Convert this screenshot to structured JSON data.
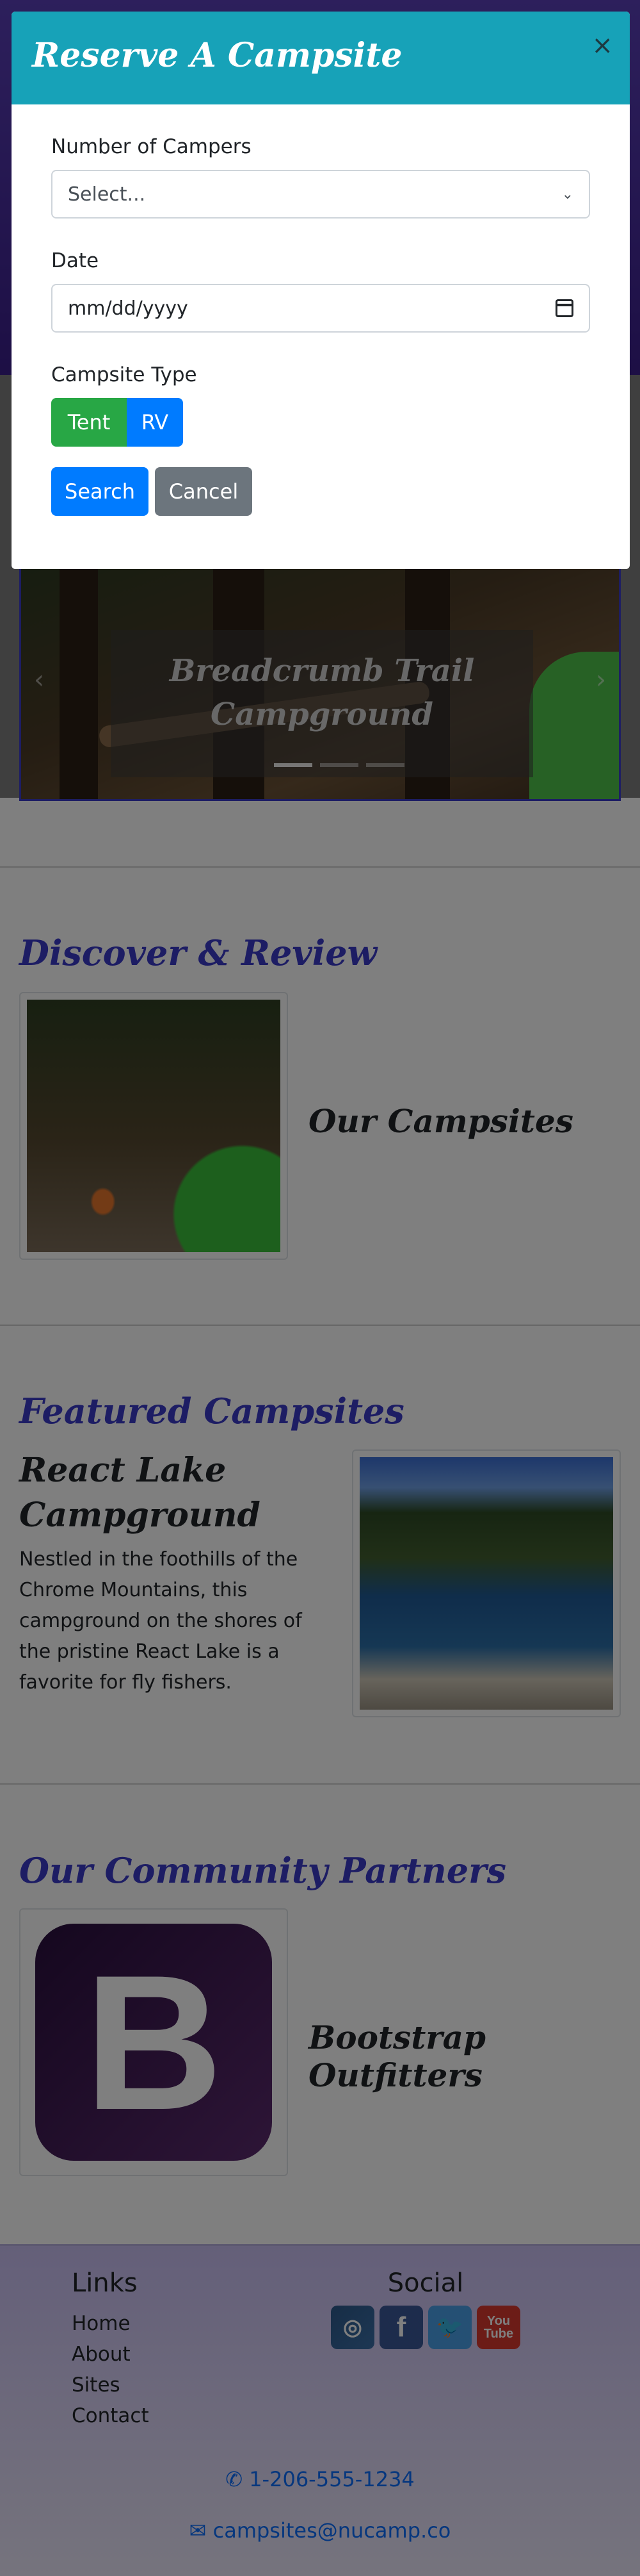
{
  "modal": {
    "title": "Reserve A Campsite",
    "close_glyph": "×",
    "campers_label": "Number of Campers",
    "campers_value": "Select...",
    "date_label": "Date",
    "date_value": "mm/dd/yyyy",
    "type_label": "Campsite Type",
    "type_options": [
      "Tent",
      "RV"
    ],
    "search_label": "Search",
    "cancel_label": "Cancel"
  },
  "carousel": {
    "caption": "Breadcrumb Trail Campground",
    "prev_glyph": "‹",
    "next_glyph": "›",
    "slides": 3
  },
  "sections": {
    "discover": {
      "title": "Discover & Review",
      "item": "Our Campsites"
    },
    "featured": {
      "title": "Featured Campsites",
      "campsite_name": "React Lake Campground",
      "campsite_desc": "Nestled in the foothills of the Chrome Mountains, this campground on the shores of the pristine React Lake is a favorite for fly fishers."
    },
    "partners": {
      "title": "Our Community Partners",
      "item": "Bootstrap Outfitters",
      "logo_letter": "B"
    }
  },
  "footer": {
    "links_title": "Links",
    "links": [
      "Home",
      "About",
      "Sites",
      "Contact"
    ],
    "social_title": "Social",
    "social_icons": [
      "instagram-icon",
      "facebook-icon",
      "twitter-icon",
      "youtube-icon"
    ],
    "phone": "1-206-555-1234",
    "email": "campsites@nucamp.co"
  },
  "colors": {
    "modal_header": "#17a2b8",
    "heading_blue": "#3a3ac8",
    "tent_green": "#28a745",
    "primary_blue": "#007bff",
    "cancel_gray": "#6c757d"
  }
}
